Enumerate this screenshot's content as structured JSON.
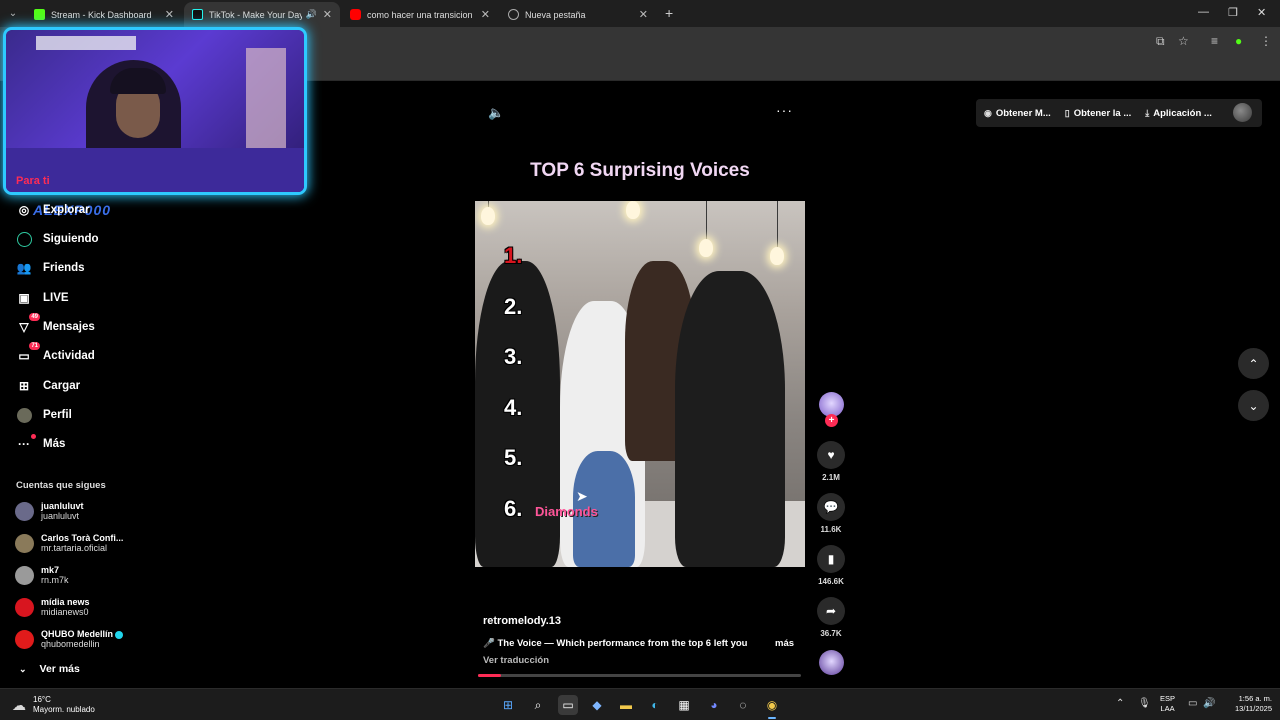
{
  "browser": {
    "tabs": [
      {
        "title": "Stream - Kick Dashboard",
        "favicon_color": "#53fc18",
        "active": false
      },
      {
        "title": "TikTok - Make Your Day",
        "favicon_color": "#111111",
        "active": true
      },
      {
        "title": "como hacer una transicion - Yo",
        "favicon_color": "#ff0000",
        "active": false
      },
      {
        "title": "Nueva pestaña",
        "favicon_color": "#888888",
        "active": false
      }
    ],
    "new_tab_icon": "plus-icon"
  },
  "webcam": {
    "overlay_name": "ALEXP000"
  },
  "sidebar": {
    "for_you": "Para ti",
    "items": [
      {
        "label": "Explorar",
        "icon": "compass-icon"
      },
      {
        "label": "Siguiendo",
        "icon": "following-icon"
      },
      {
        "label": "Friends",
        "icon": "friends-icon"
      },
      {
        "label": "LIVE",
        "icon": "live-icon"
      },
      {
        "label": "Mensajes",
        "icon": "messages-icon",
        "badge": "49"
      },
      {
        "label": "Actividad",
        "icon": "activity-icon",
        "badge": "71"
      },
      {
        "label": "Cargar",
        "icon": "upload-icon"
      },
      {
        "label": "Perfil",
        "icon": "profile-icon"
      },
      {
        "label": "Más",
        "icon": "more-icon"
      }
    ],
    "following_title": "Cuentas que sigues",
    "accounts": [
      {
        "name": "juanluluvt",
        "handle": "juanluluvt",
        "color": "#6a6a8a",
        "verified": false
      },
      {
        "name": "Carlos Torà Confi...",
        "handle": "mr.tartaria.oficial",
        "color": "#8a7a5a",
        "verified": false
      },
      {
        "name": "mk7",
        "handle": "rn.m7k",
        "color": "#9a9a9a",
        "verified": false
      },
      {
        "name": "mídia news",
        "handle": "midianews0",
        "color": "#d8151f",
        "verified": false
      },
      {
        "name": "QHUBO Medellín",
        "handle": "qhubomedellin",
        "color": "#e01b1b",
        "verified": true
      }
    ],
    "see_more": "Ver más"
  },
  "top_actions": {
    "buttons": [
      {
        "label": "Obtener M...",
        "icon": "coin-icon"
      },
      {
        "label": "Obtener la ...",
        "icon": "phone-icon"
      },
      {
        "label": "Aplicación ...",
        "icon": "download-icon"
      }
    ]
  },
  "video": {
    "title": "TOP 6 Surprising Voices",
    "ranks": [
      "1.",
      "2.",
      "3.",
      "4.",
      "5.",
      "6."
    ],
    "rank6_label": "Diamonds",
    "author": "retromelody.13",
    "description": "🎤 The Voice — Which performance from the top 6 left you",
    "more": "más",
    "translate": "Ver traducción",
    "progress": 0.07
  },
  "actions": {
    "likes": "2.1M",
    "comments": "11.6K",
    "saves": "146.6K",
    "shares": "36.7K"
  },
  "taskbar": {
    "temperature": "16°C",
    "weather": "Mayorm. nublado",
    "lang_line1": "ESP",
    "lang_line2": "LAA",
    "time": "1:56 a. m.",
    "date": "13/11/2025"
  },
  "colors": {
    "accent": "#fe2c55",
    "webcam_glow": "#2ec9ff"
  }
}
